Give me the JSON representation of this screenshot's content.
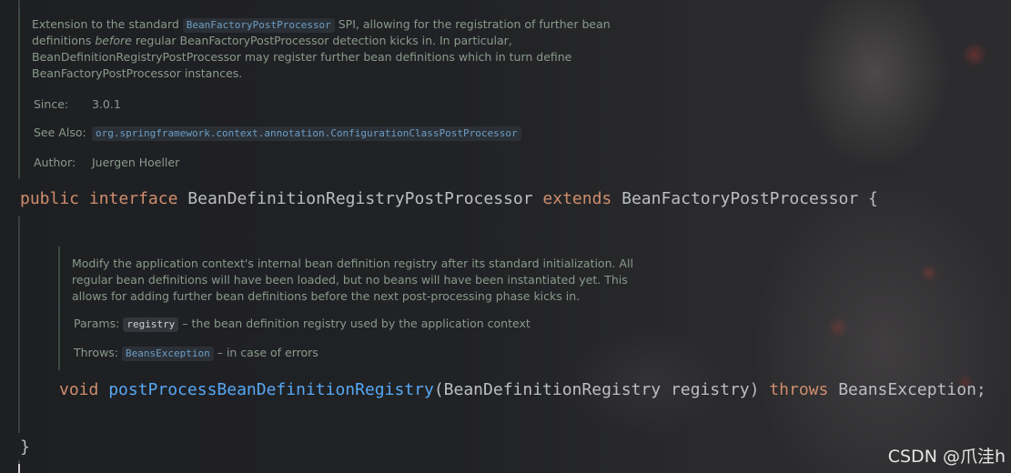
{
  "class_doc": {
    "line1_pre": "Extension to the standard",
    "line1_chip": "BeanFactoryPostProcessor",
    "line1_post": "SPI, allowing for the registration of further bean",
    "line2_pre": "definitions",
    "line2_em": "before",
    "line2_post": "regular BeanFactoryPostProcessor detection kicks in. In particular,",
    "line3": "BeanDefinitionRegistryPostProcessor may register further bean definitions which in turn define",
    "line4": "BeanFactoryPostProcessor instances.",
    "since_label": "Since:",
    "since_value": "3.0.1",
    "see_also_label": "See Also:",
    "see_also_value": "org.springframework.context.annotation.ConfigurationClassPostProcessor",
    "author_label": "Author:",
    "author_value": "Juergen Hoeller"
  },
  "interface_decl": {
    "kw_public": "public",
    "kw_interface": "interface",
    "name": "BeanDefinitionRegistryPostProcessor",
    "kw_extends": "extends",
    "parent": "BeanFactoryPostProcessor",
    "brace_open": "{"
  },
  "method_doc": {
    "line1": "Modify the application context's internal bean definition registry after its standard initialization. All",
    "line2": "regular bean definitions will have been loaded, but no beans will have been instantiated yet. This",
    "line3": "allows for adding further bean definitions before the next post-processing phase kicks in.",
    "params_label": "Params:",
    "params_chip": "registry",
    "params_desc": "– the bean definition registry used by the application context",
    "throws_label": "Throws:",
    "throws_chip": "BeansException",
    "throws_desc": "– in case of errors"
  },
  "method_decl": {
    "kw_void": "void",
    "name": "postProcessBeanDefinitionRegistry",
    "paren_open": "(",
    "param_type": "BeanDefinitionRegistry",
    "param_name": "registry",
    "paren_close": ")",
    "kw_throws": "throws",
    "exception": "BeansException",
    "semicolon": ";"
  },
  "closing_brace": "}",
  "watermark": "CSDN @爪洼h",
  "colors": {
    "keyword": "#cf8e6d",
    "method": "#56a8f5",
    "doc_text": "#8a9a8c",
    "link_chip": "#6c9ec7"
  }
}
